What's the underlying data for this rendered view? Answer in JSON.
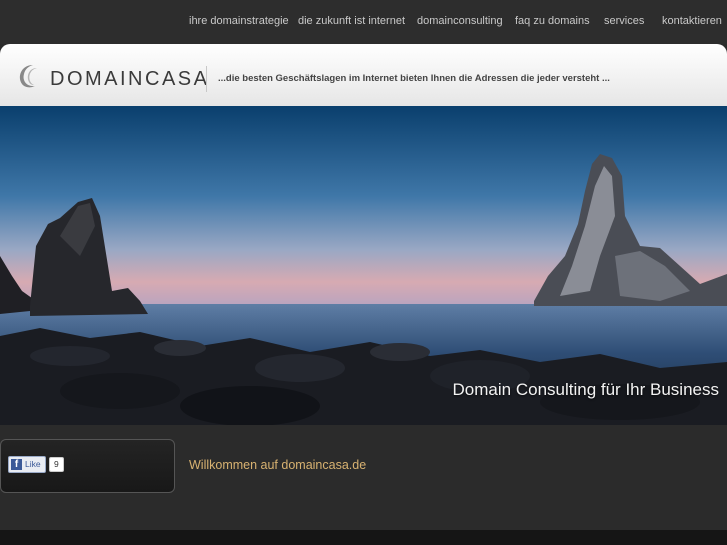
{
  "nav": {
    "items": [
      {
        "label": "ihre domainstrategie"
      },
      {
        "label": "die zukunft ist internet"
      },
      {
        "label": "domainconsulting"
      },
      {
        "label": "faq zu domains"
      },
      {
        "label": "services"
      },
      {
        "label": "kontaktieren"
      }
    ]
  },
  "header": {
    "logo_text": "DOMAINCASA",
    "tagline": "...die besten Geschäftslagen im Internet bieten Ihnen die Adressen die jeder versteht ..."
  },
  "hero": {
    "caption": "Domain Consulting für Ihr Business"
  },
  "social": {
    "like_label": "Like",
    "like_count": "9"
  },
  "main": {
    "welcome": "Willkommen auf domaincasa.de"
  },
  "colors": {
    "background": "#2b2b2b",
    "accent_gold": "#d8b271",
    "facebook_blue": "#3b5998"
  }
}
